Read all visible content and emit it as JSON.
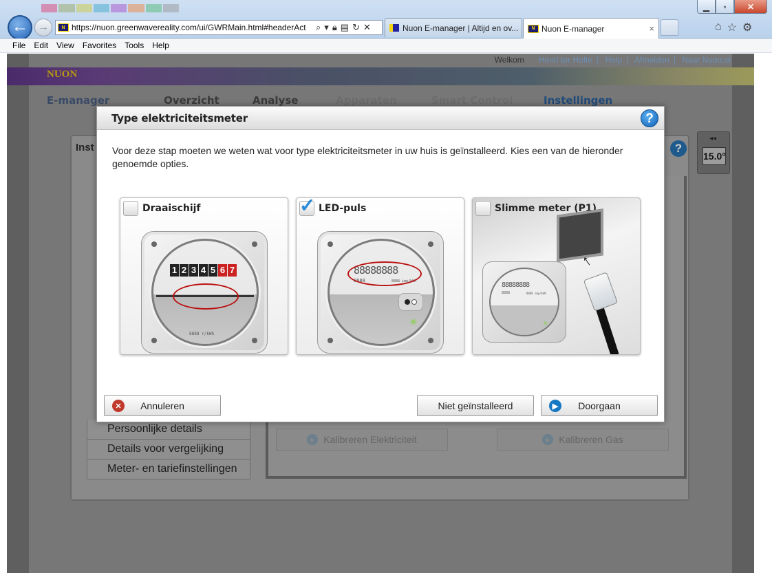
{
  "browser": {
    "url": "https://nuon.greenwavereality.com/ui/GWRMain.html#headerAct",
    "tabs": [
      {
        "label": "Nuon E-manager | Altijd en ov..."
      },
      {
        "label": "Nuon E-manager",
        "close": "×"
      }
    ],
    "window_buttons": {
      "minimize": "▁",
      "maximize": "▫",
      "close": "✕"
    },
    "menu": [
      "File",
      "Edit",
      "View",
      "Favorites",
      "Tools",
      "Help"
    ]
  },
  "site": {
    "top_links": {
      "welcome": "Welkom",
      "user": "Henri ter Hofte",
      "help": "Help",
      "logout": "Afmelden",
      "naar_nuon": "Naar Nuon.nl"
    },
    "logo": "NUON",
    "nav": {
      "brand": "E-manager",
      "items": [
        "Overzicht",
        "Analyse",
        "Apparaten",
        "Smart Control",
        "Instellingen"
      ]
    },
    "panel_title": "Inst",
    "side_items": [
      "Persoonlijke details",
      "Details voor vergelijking",
      "Meter- en tariefinstellingen"
    ],
    "calibrate": {
      "electricity": "Kalibreren Elektriciteit",
      "gas": "Kalibreren Gas"
    },
    "thermostat": {
      "value": "15.0°"
    }
  },
  "modal": {
    "title": "Type elektriciteitsmeter",
    "intro": "Voor deze stap moeten we weten wat voor type elektriciteitsmeter in uw huis is geïnstalleerd. Kies een van de hieronder genoemde opties.",
    "options": [
      {
        "label": "Draaischijf",
        "checked": false,
        "counter": [
          "1",
          "2",
          "3",
          "4",
          "5",
          "6",
          "7"
        ],
        "unit": "8888 r/kWh"
      },
      {
        "label": "LED-puls",
        "checked": true,
        "display": "88888888",
        "small": "8888",
        "unit": "8888 imp/kWh"
      },
      {
        "label": "Slimme meter (P1)",
        "checked": false,
        "display": "88888888",
        "small": "8888",
        "unit": "8888 imp/kWh"
      }
    ],
    "buttons": {
      "cancel": "Annuleren",
      "not_installed": "Niet geïnstalleerd",
      "continue": "Doorgaan"
    }
  },
  "colors": {
    "accent": "#0f62b6",
    "cancel": "#c0392b",
    "nuon_yellow": "#f5d700"
  }
}
